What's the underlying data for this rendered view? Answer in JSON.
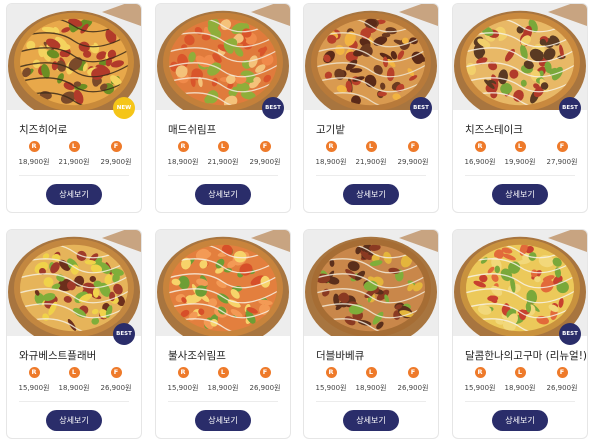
{
  "colors": {
    "accent_orange": "#ee7a2a",
    "button_navy": "#2a2d6a",
    "badge_best": "#2a2d6a",
    "badge_new": "#f5c518"
  },
  "detail_label": "상세보기",
  "sizes": [
    "R",
    "L",
    "F"
  ],
  "menu": [
    {
      "name": "치즈히어로",
      "badge": "NEW",
      "prices": [
        "18,900원",
        "21,900원",
        "29,900원"
      ],
      "topping": "cheese"
    },
    {
      "name": "매드쉬림프",
      "badge": "BEST",
      "prices": [
        "18,900원",
        "21,900원",
        "29,900원"
      ],
      "topping": "shrimp"
    },
    {
      "name": "고기밭",
      "badge": "BEST",
      "prices": [
        "18,900원",
        "21,900원",
        "29,900원"
      ],
      "topping": "meat"
    },
    {
      "name": "치즈스테이크",
      "badge": "BEST",
      "prices": [
        "16,900원",
        "19,900원",
        "27,900원"
      ],
      "topping": "steak"
    },
    {
      "name": "와규베스트플래버",
      "badge": "BEST",
      "prices": [
        "15,900원",
        "18,900원",
        "26,900원"
      ],
      "topping": "wagyu"
    },
    {
      "name": "불사조쉬림프",
      "badge": "",
      "prices": [
        "15,900원",
        "18,900원",
        "26,900원"
      ],
      "topping": "shrimp2"
    },
    {
      "name": "더블바베큐",
      "badge": "",
      "prices": [
        "15,900원",
        "18,900원",
        "26,900원"
      ],
      "topping": "bbq"
    },
    {
      "name": "달콤한나의고구마 (리뉴얼!)",
      "badge": "BEST",
      "prices": [
        "15,900원",
        "18,900원",
        "26,900원"
      ],
      "topping": "sweetpotato"
    }
  ]
}
